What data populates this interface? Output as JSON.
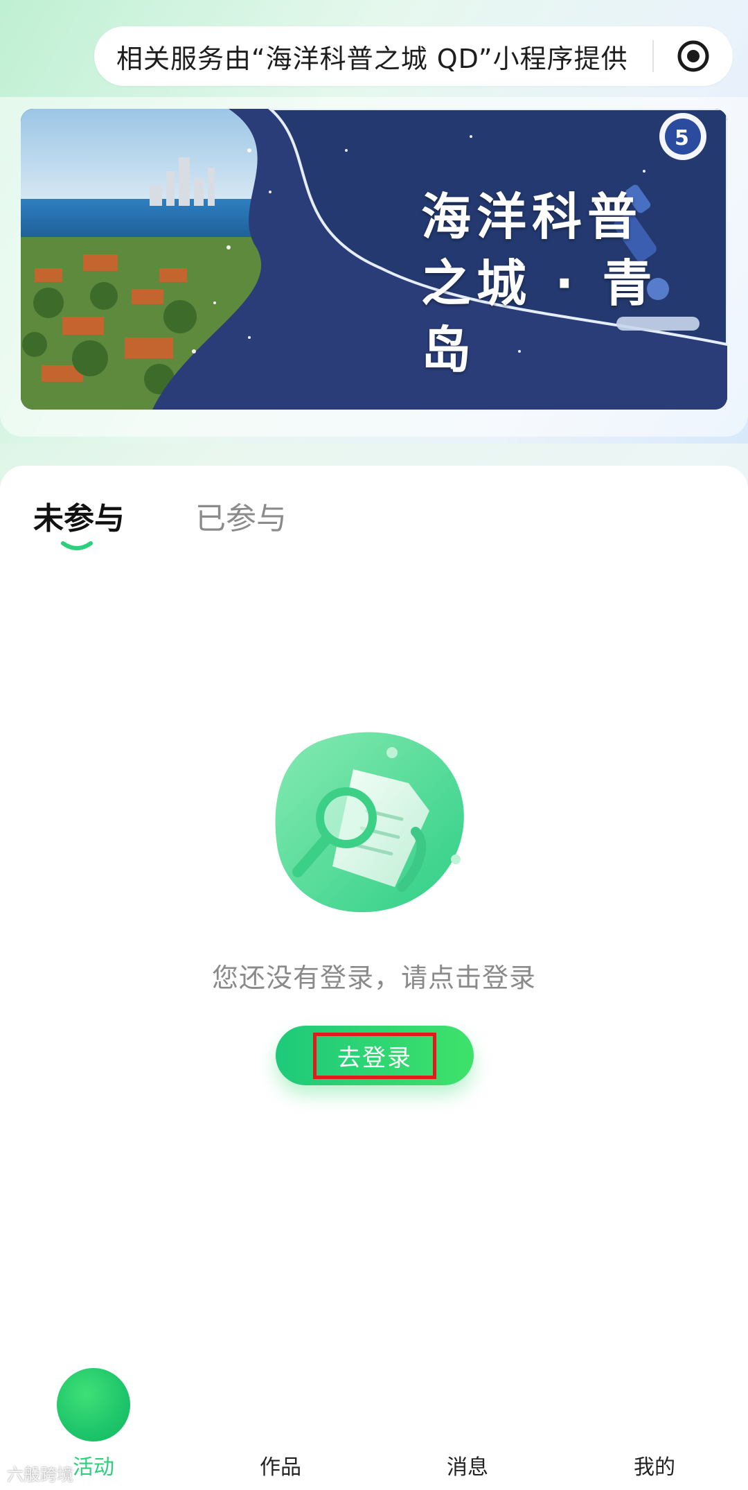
{
  "header": {
    "notice": "相关服务由“海洋科普之城 QD”小程序提供",
    "target_icon": "target-icon"
  },
  "banner": {
    "line1": "海洋科普",
    "line2": "之城 · 青岛",
    "logo_icon": "school-logo-icon",
    "microscope_icon": "microscope-icon"
  },
  "tabs": [
    {
      "label": "未参与",
      "active": true
    },
    {
      "label": "已参与",
      "active": false
    }
  ],
  "empty_state": {
    "illustration_icon": "magnifier-document-icon",
    "message": "您还没有登录，请点击登录",
    "button_label": "去登录"
  },
  "tabbar": {
    "items": [
      {
        "label": "活动",
        "active": true
      },
      {
        "label": "作品",
        "active": false
      },
      {
        "label": "消息",
        "active": false
      },
      {
        "label": "我的",
        "active": false
      }
    ]
  },
  "watermark": "六般跨境",
  "colors": {
    "accent": "#2bd07a",
    "button_start": "#1ec97a",
    "button_end": "#3ee26a",
    "highlight_border": "#e11a1a"
  }
}
